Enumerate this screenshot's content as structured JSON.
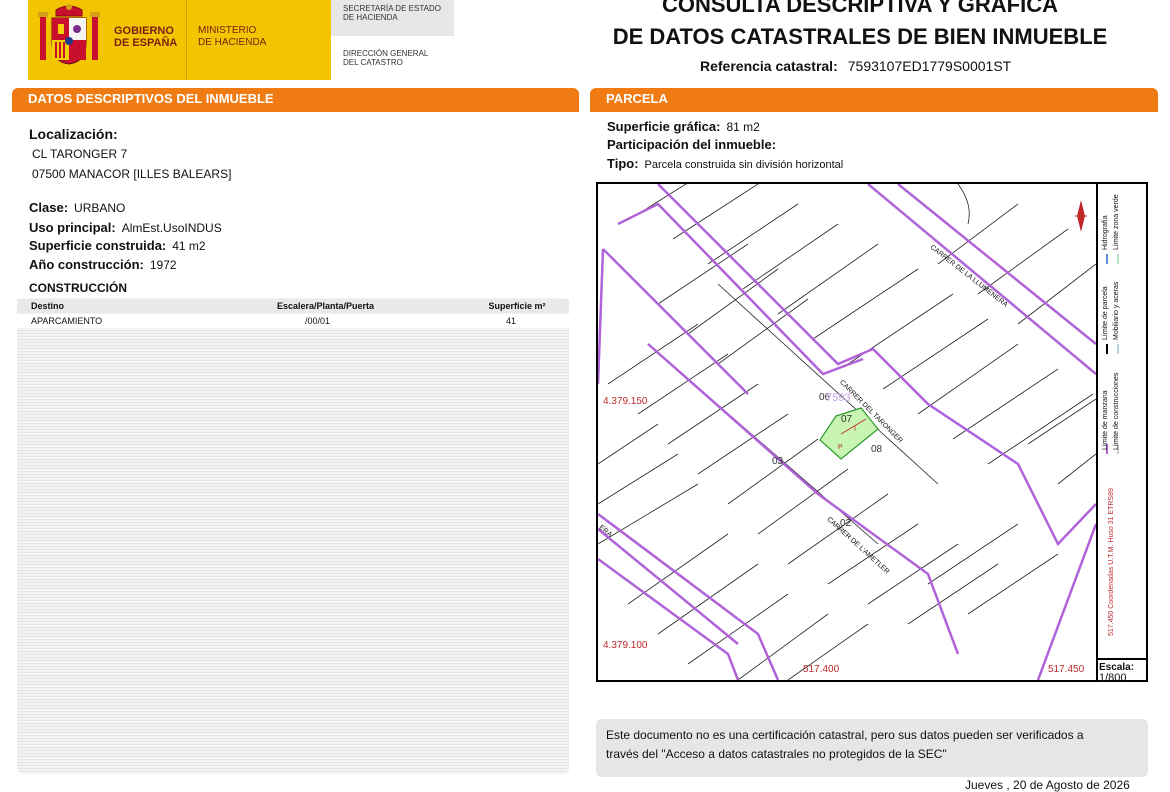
{
  "header": {
    "gobierno": [
      "GOBIERNO",
      "DE ESPAÑA"
    ],
    "ministerio": [
      "MINISTERIO",
      "DE HACIENDA"
    ],
    "secretaria": [
      "SECRETARÍA DE ESTADO",
      "DE HACIENDA"
    ],
    "direccion": [
      "DIRECCIÓN GENERAL",
      "DEL CATASTRO"
    ],
    "title_line1": "CONSULTA DESCRIPTIVA Y GRÁFICA",
    "title_line2": "DE DATOS CATASTRALES DE BIEN INMUEBLE",
    "ref_label": "Referencia catastral:",
    "ref_value": "7593107ED1779S0001ST"
  },
  "left": {
    "section_title": "DATOS DESCRIPTIVOS DEL INMUEBLE",
    "localizacion_label": "Localización:",
    "localizacion_line1": "CL TARONGER 7",
    "localizacion_line2": "07500 MANACOR [ILLES BALEARS]",
    "clase_label": "Clase:",
    "clase_value": "URBANO",
    "uso_label": "Uso principal:",
    "uso_value": "AlmEst.UsoINDUS",
    "superficie_label": "Superficie construida:",
    "superficie_value": "41 m2",
    "anio_label": "Año construcción:",
    "anio_value": "1972",
    "construccion_title": "CONSTRUCCIÓN",
    "table": {
      "headers": [
        "Destino",
        "Escalera/Planta/Puerta",
        "Superficie m²"
      ],
      "rows": [
        [
          "APARCAMIENTO",
          "/00/01",
          "41"
        ]
      ]
    }
  },
  "right": {
    "section_title": "PARCELA",
    "sup_grafica_label": "Superficie gráfica:",
    "sup_grafica_value": "81 m2",
    "participacion_label": "Participación del inmueble:",
    "tipo_label": "Tipo:",
    "tipo_value": "Parcela construida sin división horizontal"
  },
  "map": {
    "street_labels": [
      "CARRER DE LA LLUMENERA",
      "CARRER DEL TARONGER",
      "CARRER DE L'AMETLER",
      "ERA"
    ],
    "coords": [
      "4.379.150",
      "4.379.100",
      "517.400",
      "517.450"
    ],
    "parcel_labels": [
      "06",
      "07",
      "08",
      "03",
      "02",
      "7593"
    ],
    "legend": {
      "items": [
        "Límite de manzana",
        "Límite de construcciones",
        "Límite de parcela",
        "Mobiliario y aceras",
        "Hidrografía",
        "Límite zona verde"
      ],
      "coords_system": "517.450 Coordenadas U.T.M. Huso 31 ETRS89"
    },
    "scale_label": "Escala:",
    "scale_value": "1/800",
    "colors": {
      "frame": "#000000",
      "manzana": "#b062d8",
      "parcel_fill": "#c8f5b4",
      "parcel_line": "#2b9b2b",
      "coord_text": "#c0292b",
      "number_text": "#2a3fa0"
    }
  },
  "note": {
    "line1": "Este documento no es una certificación catastral, pero sus datos pueden ser verificados a",
    "line2": "través del \"Acceso a datos catastrales no protegidos de la SEC\""
  },
  "footer": {
    "date": "Jueves , 20 de Agosto de 2026"
  },
  "colors": {
    "orange": "#f07b13",
    "yellow": "#f2c500"
  }
}
